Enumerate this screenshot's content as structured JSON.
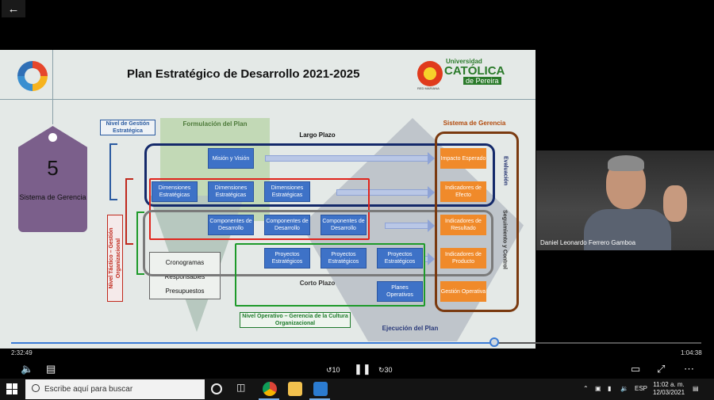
{
  "player": {
    "back_icon": "arrow-left-icon",
    "elapsed": "2:32:49",
    "remaining": "1:04:38",
    "progress_fraction": 0.7
  },
  "slide": {
    "title": "Plan Estratégico de Desarrollo 2021-2025",
    "university": {
      "line1": "Universidad",
      "line2": "CATÓLICA",
      "line3": "de Pereira",
      "line4": "RED MARIANA"
    },
    "tag": {
      "number": "5",
      "label": "Sistema de Gerencia"
    },
    "labels": {
      "nivel_gestion": "Nivel de Gestión Estratégica",
      "formulacion": "Formulación del Plan",
      "largo_plazo": "Largo Plazo",
      "sistema_gerencia": "Sistema de Gerencia",
      "evaluacion": "Evaluación",
      "seguimiento": "Seguimiento y Control",
      "nivel_tactico": "Nivel Táctico – Gestión Organizacional",
      "corto_plazo": "Corto Plazo",
      "nivel_operativo": "Nivel Operativo – Gerencia de la Cultura Organizacional",
      "ejecucion": "Ejecución del Plan"
    },
    "blue_boxes": {
      "mision": "Misión y Visión",
      "dim1": "Dimensiones Estratégicas",
      "dim2": "Dimensiones Estratégicas",
      "dim3": "Dimensiones Estratégicas",
      "comp1": "Componentes de Desarrollo",
      "comp2": "Componentes de Desarrollo",
      "comp3": "Componentes de Desarrollo",
      "proy1": "Proyectos Estratégicos",
      "proy2": "Proyectos Estratégicos",
      "proy3": "Proyectos Estratégicos",
      "planes": "Planes Operativos"
    },
    "orange_boxes": {
      "impacto": "Impacto Esperado",
      "efecto": "Indicadores de Efecto",
      "resultado": "Indicadores de Resultado",
      "producto": "Indicadores de Producto",
      "gestion": "Gestión Operativa"
    },
    "white_box": [
      "Cronogramas",
      "Responsables",
      "Presupuestos"
    ]
  },
  "webcam": {
    "participant_name": "Daniel Leonardo Ferrero Gamboa"
  },
  "controls": {
    "volume_icon": "volume-icon",
    "captions_icon": "captions-icon",
    "rewind_icon": "rewind-10-icon",
    "rewind_label": "10",
    "pause_icon": "pause-icon",
    "forward_icon": "forward-30-icon",
    "forward_label": "30",
    "cast_icon": "cast-icon",
    "fullscreen_icon": "fullscreen-icon",
    "more_icon": "more-icon"
  },
  "taskbar": {
    "search_placeholder": "Escribe aquí para buscar",
    "lang": "ESP",
    "time": "11:02 a. m.",
    "date": "12/03/2021"
  }
}
